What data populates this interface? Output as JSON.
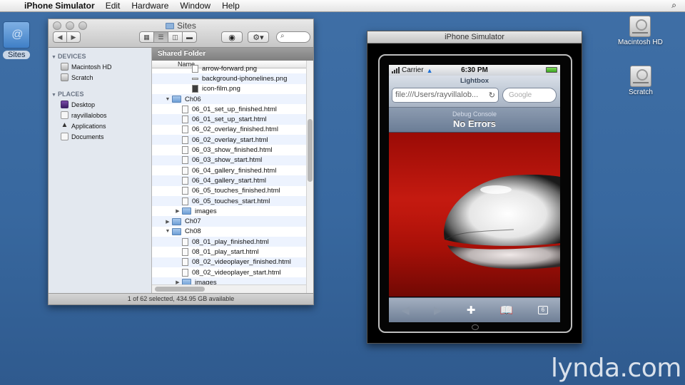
{
  "menubar": {
    "app_name": "iPhone Simulator",
    "menus": [
      "Edit",
      "Hardware",
      "Window",
      "Help"
    ]
  },
  "desktop": {
    "sites_label": "Sites",
    "macintosh_hd_label": "Macintosh HD",
    "scratch_label": "Scratch"
  },
  "finder": {
    "title": "Sites",
    "search_placeholder": "",
    "path": "Shared Folder",
    "column_name": "Name",
    "sidebar": {
      "devices_header": "DEVICES",
      "devices": [
        "Macintosh HD",
        "Scratch"
      ],
      "places_header": "PLACES",
      "places": [
        "Desktop",
        "rayvillalobos",
        "Applications",
        "Documents"
      ]
    },
    "rows": [
      {
        "name": "arrow-forward.png",
        "level": 2,
        "kind": "file"
      },
      {
        "name": "background-iphonelines.png",
        "level": 2,
        "kind": "line"
      },
      {
        "name": "icon-film.png",
        "level": 2,
        "kind": "image"
      },
      {
        "name": "Ch06",
        "level": 0,
        "kind": "folder",
        "expanded": true
      },
      {
        "name": "06_01_set_up_finished.html",
        "level": 1,
        "kind": "file"
      },
      {
        "name": "06_01_set_up_start.html",
        "level": 1,
        "kind": "file"
      },
      {
        "name": "06_02_overlay_finished.html",
        "level": 1,
        "kind": "file"
      },
      {
        "name": "06_02_overlay_start.html",
        "level": 1,
        "kind": "file"
      },
      {
        "name": "06_03_show_finished.html",
        "level": 1,
        "kind": "file"
      },
      {
        "name": "06_03_show_start.html",
        "level": 1,
        "kind": "file"
      },
      {
        "name": "06_04_gallery_finished.html",
        "level": 1,
        "kind": "file"
      },
      {
        "name": "06_04_gallery_start.html",
        "level": 1,
        "kind": "file"
      },
      {
        "name": "06_05_touches_finished.html",
        "level": 1,
        "kind": "file"
      },
      {
        "name": "06_05_touches_start.html",
        "level": 1,
        "kind": "file"
      },
      {
        "name": "images",
        "level": 1,
        "kind": "folder",
        "expanded": false
      },
      {
        "name": "Ch07",
        "level": 0,
        "kind": "folder",
        "expanded": false
      },
      {
        "name": "Ch08",
        "level": 0,
        "kind": "folder",
        "expanded": true
      },
      {
        "name": "08_01_play_finished.html",
        "level": 1,
        "kind": "file"
      },
      {
        "name": "08_01_play_start.html",
        "level": 1,
        "kind": "file"
      },
      {
        "name": "08_02_videoplayer_finished.html",
        "level": 1,
        "kind": "file"
      },
      {
        "name": "08_02_videoplayer_start.html",
        "level": 1,
        "kind": "file"
      },
      {
        "name": "images",
        "level": 1,
        "kind": "folder",
        "expanded": false
      }
    ],
    "status": "1 of 62 selected, 434.95 GB available"
  },
  "simulator": {
    "title": "iPhone Simulator",
    "carrier": "Carrier",
    "time": "6:30 PM",
    "page_title": "Lightbox",
    "url": "file:///Users/rayvillalob...",
    "search_placeholder": "Google",
    "debug_label": "Debug Console",
    "debug_message": "No Errors",
    "tabs_count": "6"
  },
  "watermark": "lynda.com"
}
